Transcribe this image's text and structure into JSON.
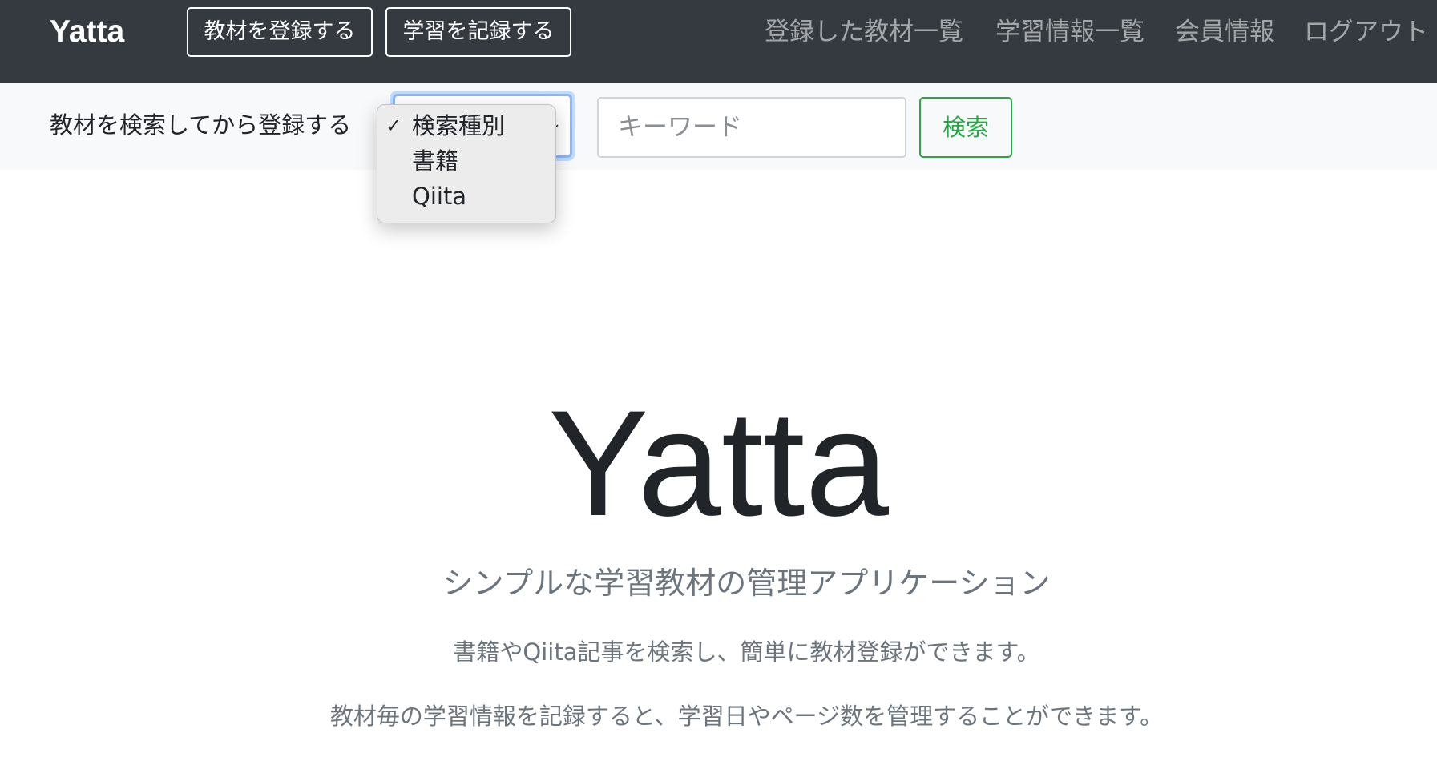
{
  "navbar": {
    "brand": "Yatta",
    "buttons": [
      {
        "label": "教材を登録する"
      },
      {
        "label": "学習を記録する"
      }
    ],
    "links": [
      {
        "label": "登録した教材一覧"
      },
      {
        "label": "学習情報一覧"
      },
      {
        "label": "会員情報"
      },
      {
        "label": "ログアウト"
      }
    ]
  },
  "search": {
    "label": "教材を検索してから登録する",
    "select": {
      "options": [
        {
          "label": "検索種別",
          "selected": true,
          "check": "✓"
        },
        {
          "label": "書籍"
        },
        {
          "label": "Qiita"
        }
      ],
      "caret": "⌄"
    },
    "keyword_placeholder": "キーワード",
    "button_label": "検索"
  },
  "hero": {
    "title": "Yatta",
    "lead": "シンプルな学習教材の管理アプリケーション",
    "p1": "書籍やQiita記事を検索し、簡単に教材登録ができます。",
    "p2": "教材毎の学習情報を記録すると、学習日やページ数を管理することができます。"
  },
  "colors": {
    "navbar_bg": "#343a40",
    "search_bg": "#f8f9fa",
    "success": "#28a745",
    "muted": "#6c757d"
  }
}
